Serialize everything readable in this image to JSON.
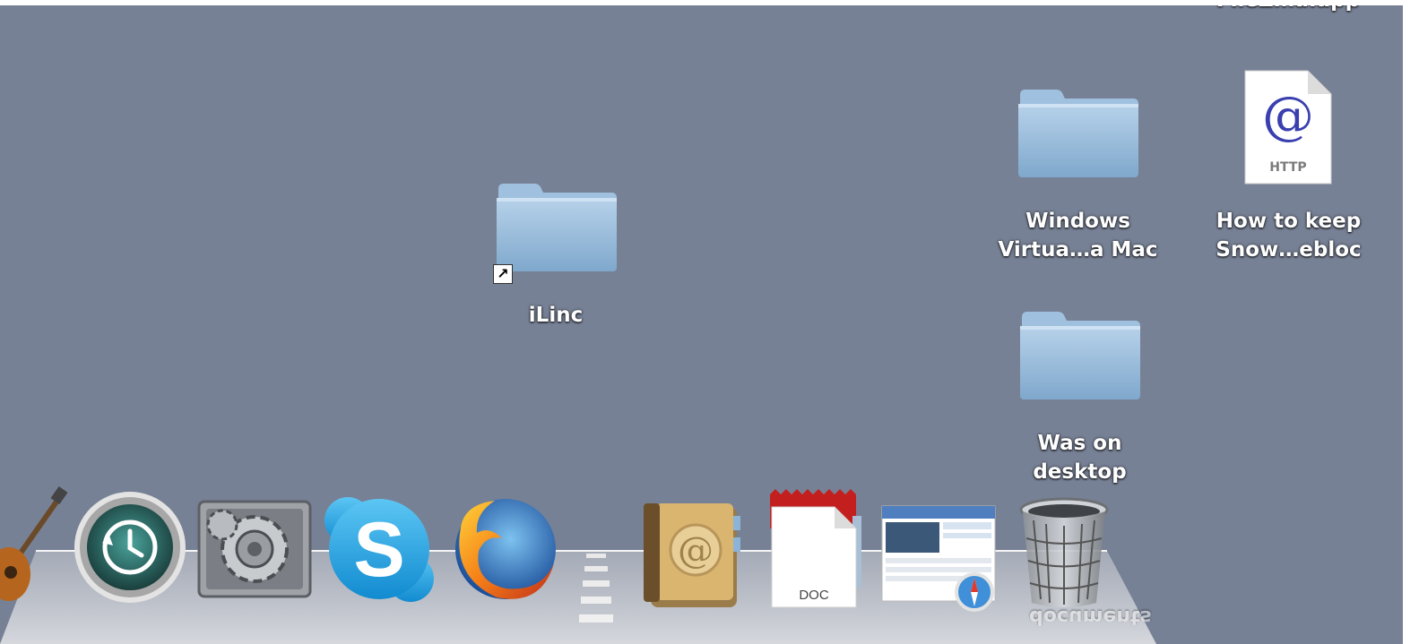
{
  "desktop": {
    "icons": [
      {
        "label": "FileZilla.app"
      },
      {
        "label": "Windows\nVirtua…a Mac"
      },
      {
        "label": "How to keep\nSnow…ebloc"
      },
      {
        "label": "iLinc"
      },
      {
        "label": "Was on\ndesktop"
      }
    ],
    "webloc_badge": "HTTP",
    "webloc_symbol": "@"
  },
  "dock": {
    "items": [
      {
        "icon": "garageband-guitar-icon"
      },
      {
        "icon": "time-machine-icon"
      },
      {
        "icon": "system-preferences-icon"
      },
      {
        "icon": "skype-icon"
      },
      {
        "icon": "firefox-icon"
      },
      {
        "icon": "address-book-icon"
      },
      {
        "icon": "doc-stack-icon",
        "label": "DOC"
      },
      {
        "icon": "safari-downloads-stack-icon"
      },
      {
        "icon": "trash-icon"
      }
    ],
    "stack_label_reflection": "documents"
  },
  "colors": {
    "desktop_bg": "#778195",
    "folder_blue": "#8fb5d6",
    "label_text": "#ffffff"
  }
}
